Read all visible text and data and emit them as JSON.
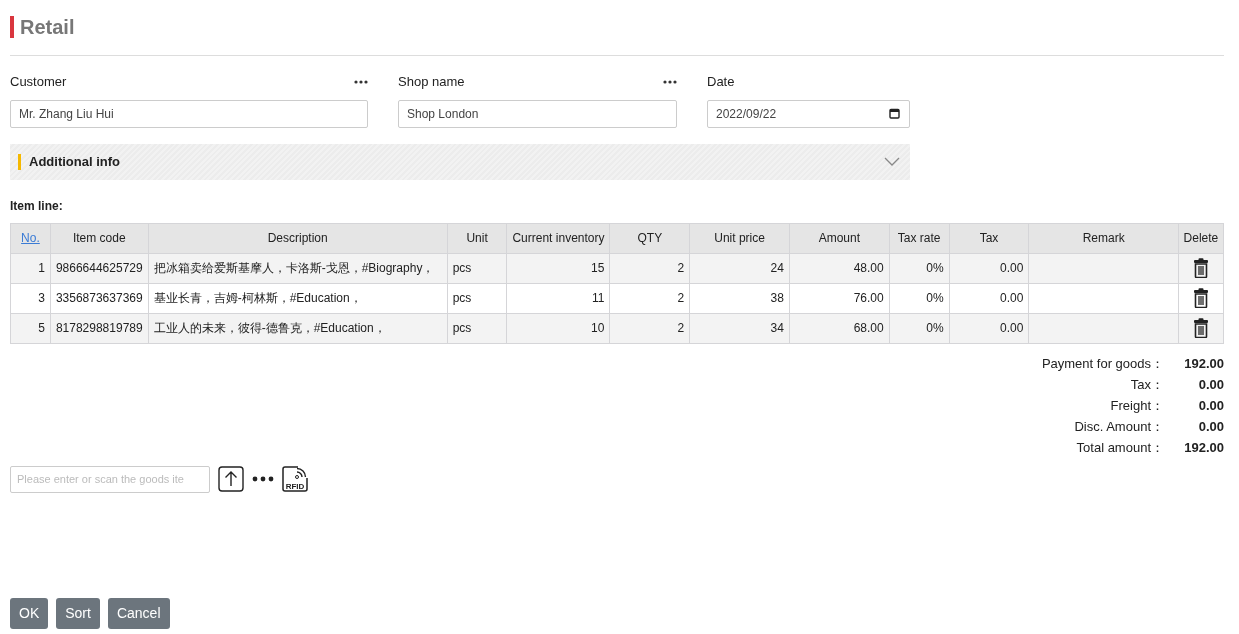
{
  "title": "Retail",
  "fields": [
    {
      "kind": "picker",
      "label": "Customer",
      "value": "Mr. Zhang Liu Hui"
    },
    {
      "kind": "picker",
      "label": "Shop name",
      "value": "Shop London"
    },
    {
      "kind": "date",
      "label": "Date",
      "value": "2022/09/22"
    }
  ],
  "additional_info": {
    "label": "Additional info",
    "expanded": false
  },
  "item_line_label": "Item line:",
  "table": {
    "columns": [
      {
        "label": "No.",
        "kind": "link"
      },
      {
        "label": "Item code"
      },
      {
        "label": "Description"
      },
      {
        "label": "Unit"
      },
      {
        "label": "Current inventory"
      },
      {
        "label": "QTY"
      },
      {
        "label": "Unit price"
      },
      {
        "label": "Amount"
      },
      {
        "label": "Tax rate"
      },
      {
        "label": "Tax"
      },
      {
        "label": "Remark"
      },
      {
        "label": "Delete"
      }
    ],
    "rows": [
      {
        "no": "1",
        "item_code": "9866644625729",
        "description": "把冰箱卖给爱斯基摩人，卡洛斯-戈恩，#Biography，",
        "unit": "pcs",
        "current_inventory": "15",
        "qty": "2",
        "unit_price": "24",
        "amount": "48.00",
        "tax_rate": "0%",
        "tax": "0.00"
      },
      {
        "no": "3",
        "item_code": "3356873637369",
        "description": "基业长青，吉姆-柯林斯，#Education，",
        "unit": "pcs",
        "current_inventory": "11",
        "qty": "2",
        "unit_price": "38",
        "amount": "76.00",
        "tax_rate": "0%",
        "tax": "0.00"
      },
      {
        "no": "5",
        "item_code": "8178298819789",
        "description": "工业人的未来，彼得-德鲁克，#Education，",
        "unit": "pcs",
        "current_inventory": "10",
        "qty": "2",
        "unit_price": "34",
        "amount": "68.00",
        "tax_rate": "0%",
        "tax": "0.00"
      }
    ]
  },
  "summary": [
    {
      "label": "Payment for goods：",
      "value": "192.00"
    },
    {
      "label": "Tax：",
      "value": "0.00"
    },
    {
      "label": "Freight：",
      "value": "0.00"
    },
    {
      "label": "Disc. Amount：",
      "value": "0.00"
    },
    {
      "label": "Total amount：",
      "value": "192.00"
    }
  ],
  "scan": {
    "placeholder": "Please enter or scan the goods ite",
    "rfid_label": "RFID"
  },
  "buttons": [
    "OK",
    "Sort",
    "Cancel"
  ]
}
